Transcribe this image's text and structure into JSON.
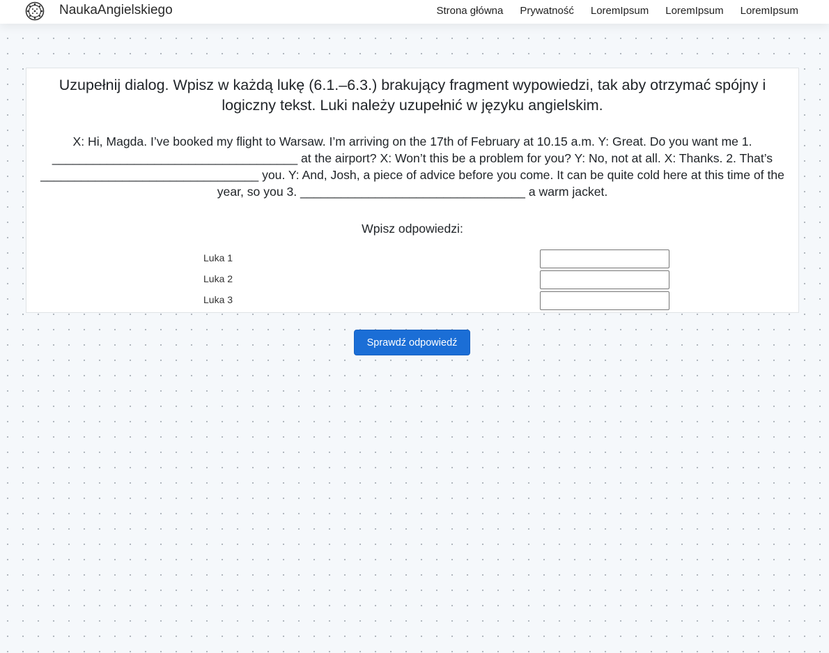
{
  "navbar": {
    "logo_icon": "gear-dots-logo",
    "brand": "NaukaAngielskiego",
    "links": [
      "Strona główna",
      "Prywatność",
      "LoremIpsum",
      "LoremIpsum",
      "LoremIpsum"
    ]
  },
  "task": {
    "instruction": "Uzupełnij dialog. Wpisz w każdą lukę (6.1.–6.3.) brakujący fragment wypowiedzi, tak aby otrzymać spójny i logiczny tekst. Luki należy uzupełnić w języku angielskim.",
    "dialog": "X: Hi, Magda. I’ve booked my flight to Warsaw. I’m arriving on the 17th of February at 10.15 a.m. Y: Great. Do you want me 1. ____________________________________ at the airport? X: Won’t this be a problem for you? Y: No, not at all. X: Thanks. 2. That’s ________________________________ you. Y: And, Josh, a piece of advice before you come. It can be quite cold here at this time of the year, so you 3. _________________________________ a warm jacket.",
    "answers_heading": "Wpisz odpowiedzi:",
    "gaps": [
      {
        "label": "Luka 1",
        "value": ""
      },
      {
        "label": "Luka 2",
        "value": ""
      },
      {
        "label": "Luka 3",
        "value": ""
      }
    ]
  },
  "actions": {
    "check_label": "Sprawdź odpowiedź"
  },
  "colors": {
    "primary": "#1b6ed6",
    "page_background": "#f5f8fb",
    "card_background": "#ffffff"
  }
}
